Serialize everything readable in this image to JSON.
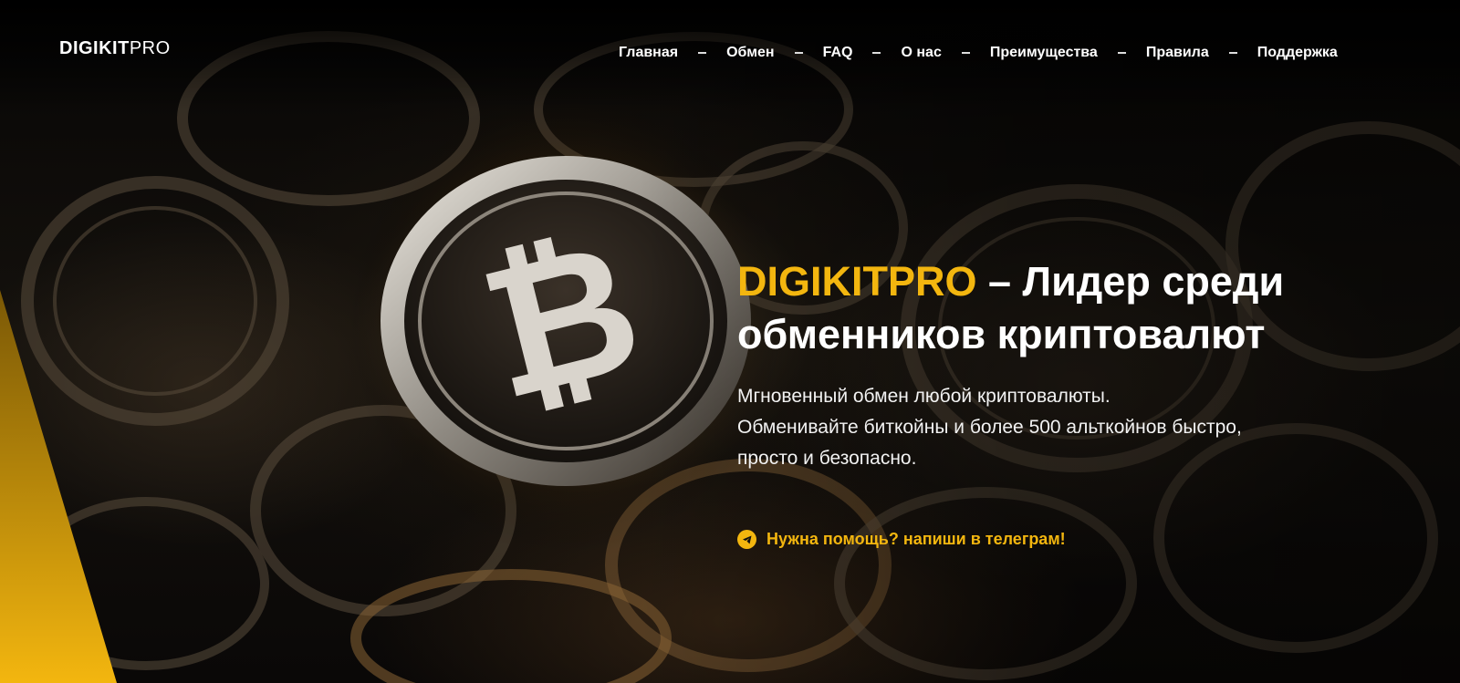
{
  "brand": {
    "logo_bold": "DIGIKIT",
    "logo_light": "PRO"
  },
  "nav": {
    "items": [
      {
        "label": "Главная"
      },
      {
        "label": "Обмен"
      },
      {
        "label": "FAQ"
      },
      {
        "label": "О нас"
      },
      {
        "label": "Преимущества"
      },
      {
        "label": "Правила"
      },
      {
        "label": "Поддержка"
      }
    ]
  },
  "hero": {
    "title_brand": "DIGIKITPRO",
    "title_rest": " – Лидер среди обменников криптовалют",
    "subtitle_line1": "Мгновенный обмен любой криптовалюты.",
    "subtitle_line2": "Обменивайте биткойны и более 500 альткойнов быстро,",
    "subtitle_line3": "просто и безопасно.",
    "help_link": "Нужна помощь? напиши в телеграм!",
    "help_icon": "telegram-icon",
    "background_icon": "bitcoin-coin-icon"
  },
  "colors": {
    "accent": "#f3b60f",
    "background": "#050505",
    "text": "#ffffff"
  }
}
